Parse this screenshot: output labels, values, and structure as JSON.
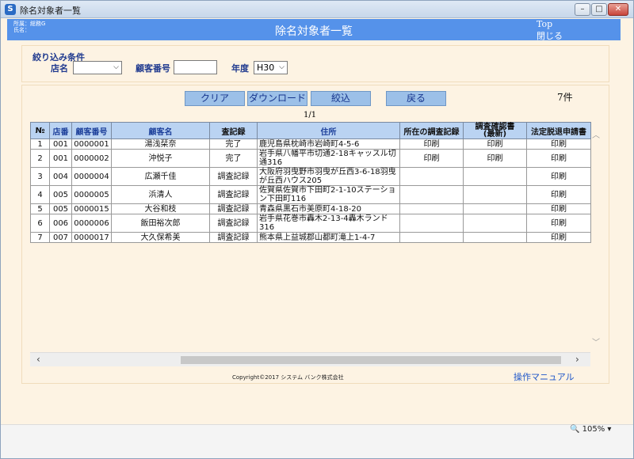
{
  "window": {
    "title": "除名対象者一覧",
    "app_icon": "S"
  },
  "header": {
    "affiliation": "所属：総務G",
    "name": "氏名：",
    "title": "除名対象者一覧",
    "top_link": "Top",
    "close_link": "閉じる"
  },
  "filter": {
    "section_label": "絞り込み条件",
    "store_label": "店名",
    "store_value": "",
    "customer_no_label": "顧客番号",
    "customer_no_value": "",
    "year_label": "年度",
    "year_value": "H30"
  },
  "toolbar": {
    "clear": "クリア",
    "download": "ダウンロード",
    "filter": "絞込",
    "back": "戻る"
  },
  "count": "7件",
  "page": "1/1",
  "table": {
    "headers": [
      "№",
      "店番",
      "顧客番号",
      "顧客名",
      "査記録",
      "住所",
      "所在の調査記録",
      "調査確認書\n(最新)",
      "法定脱退申請書"
    ],
    "rows": [
      {
        "no": "1",
        "store": "001",
        "cust_no": "0000001",
        "name": "湯浅栞奈",
        "record": "完了",
        "record_link": false,
        "address": "鹿児島県枕崎市岩崎町4-5-6",
        "survey": "印刷",
        "confirm": "印刷",
        "withdraw": "印刷"
      },
      {
        "no": "2",
        "store": "001",
        "cust_no": "0000002",
        "name": "沖悦子",
        "record": "完了",
        "record_link": false,
        "address": "岩手県八幡平市切通2-18キャッスル切通316",
        "survey": "印刷",
        "confirm": "印刷",
        "withdraw": "印刷"
      },
      {
        "no": "3",
        "store": "004",
        "cust_no": "0000004",
        "name": "広瀬千佳",
        "record": "調査記録",
        "record_link": "visited",
        "address": "大阪府羽曳野市羽曳が丘西3-6-18羽曳が丘西ハウス205",
        "survey": "",
        "confirm": "",
        "withdraw": "印刷"
      },
      {
        "no": "4",
        "store": "005",
        "cust_no": "0000005",
        "name": "浜清人",
        "record": "調査記録",
        "record_link": true,
        "address": "佐賀県佐賀市下田町2-1-10ステーション下田町116",
        "survey": "",
        "confirm": "",
        "withdraw": "印刷"
      },
      {
        "no": "5",
        "store": "005",
        "cust_no": "0000015",
        "name": "大谷和枝",
        "record": "調査記録",
        "record_link": true,
        "address": "青森県黒石市美原町4-18-20",
        "survey": "",
        "confirm": "",
        "withdraw": "印刷"
      },
      {
        "no": "6",
        "store": "006",
        "cust_no": "0000006",
        "name": "飯田裕次郎",
        "record": "調査記録",
        "record_link": true,
        "address": "岩手県花巻市轟木2-13-4轟木ランド316",
        "survey": "",
        "confirm": "",
        "withdraw": "印刷"
      },
      {
        "no": "7",
        "store": "007",
        "cust_no": "0000017",
        "name": "大久保希美",
        "record": "調査記録",
        "record_link": true,
        "address": "熊本県上益城郡山都町滝上1-4-7",
        "survey": "",
        "confirm": "",
        "withdraw": "印刷"
      }
    ]
  },
  "footer": {
    "copyright": "Copyright©2017 システム バンク株式会社",
    "manual": "操作マニュアル"
  },
  "status": {
    "zoom": "105%"
  }
}
